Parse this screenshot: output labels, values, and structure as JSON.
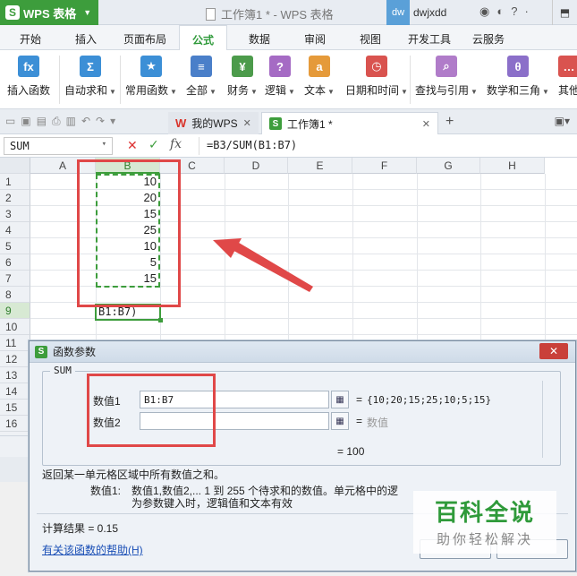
{
  "titlebar": {
    "app_name": "WPS 表格",
    "doc_title": "工作簿1 * - WPS 表格",
    "user_avatar": "dw",
    "user_name": "dwjxdd"
  },
  "menu": [
    "开始",
    "插入",
    "页面布局",
    "公式",
    "数据",
    "审阅",
    "视图",
    "开发工具",
    "云服务"
  ],
  "menu_active_index": 3,
  "ribbon": [
    {
      "label": "插入函数",
      "icon": "fx-icon",
      "glyph": "fx",
      "color": "#3c8fd6",
      "caret": false
    },
    {
      "label": "自动求和",
      "icon": "sigma-icon",
      "glyph": "Σ",
      "color": "#3c8fd6",
      "caret": true
    },
    {
      "label": "常用函数",
      "icon": "star-book-icon",
      "glyph": "★",
      "color": "#3c8fd6",
      "caret": true
    },
    {
      "label": "全部",
      "icon": "list-book-icon",
      "glyph": "≡",
      "color": "#4a7fc9",
      "caret": true
    },
    {
      "label": "财务",
      "icon": "finance-book-icon",
      "glyph": "¥",
      "color": "#4c9b4b",
      "caret": true
    },
    {
      "label": "逻辑",
      "icon": "logic-book-icon",
      "glyph": "?",
      "color": "#a56bc4",
      "caret": true
    },
    {
      "label": "文本",
      "icon": "text-book-icon",
      "glyph": "a",
      "color": "#e59a3a",
      "caret": true
    },
    {
      "label": "日期和时间",
      "icon": "clock-book-icon",
      "glyph": "◷",
      "color": "#d9534f",
      "caret": true
    },
    {
      "label": "查找与引用",
      "icon": "search-book-icon",
      "glyph": "⌕",
      "color": "#b07cc9",
      "caret": true
    },
    {
      "label": "数学和三角",
      "icon": "theta-book-icon",
      "glyph": "θ",
      "color": "#8b6fc9",
      "caret": true
    },
    {
      "label": "其他",
      "icon": "more-book-icon",
      "glyph": "…",
      "color": "#d9534f",
      "caret": false
    }
  ],
  "doc_tabs": [
    {
      "label": "我的WPS",
      "active": false
    },
    {
      "label": "工作簿1 *",
      "active": true
    }
  ],
  "formula_bar": {
    "name_box": "SUM",
    "formula": "=B3/SUM(B1:B7)"
  },
  "columns": [
    "A",
    "B",
    "C",
    "D",
    "E",
    "F",
    "G",
    "H"
  ],
  "rows": [
    "1",
    "2",
    "3",
    "4",
    "5",
    "6",
    "7",
    "8",
    "9",
    "10",
    "11",
    "12",
    "13",
    "14",
    "15",
    "16",
    "17"
  ],
  "column_b_values": [
    "10",
    "20",
    "15",
    "25",
    "10",
    "5",
    "15"
  ],
  "active_cell_text": "B1:B7)",
  "dialog": {
    "title": "函数参数",
    "function_name": "SUM",
    "arg1_label": "数值1",
    "arg1_value": "B1:B7",
    "arg1_result": "{10;20;15;25;10;5;15}",
    "arg2_label": "数值2",
    "arg2_value": "",
    "arg2_result": "数值",
    "eq": "=",
    "total": "= 100",
    "description": "返回某一单元格区域中所有数值之和。",
    "param_name": "数值1:",
    "param_text_line1": "数值1,数值2,... 1 到 255 个待求和的数值。单元格中的逻",
    "param_text_line2": "为参数键入时，逻辑值和文本有效",
    "calc_result": "计算结果 = 0.15",
    "help_link": "有关该函数的帮助(H)"
  },
  "watermark": {
    "main": "百科全说",
    "sub": "助你轻松解决"
  },
  "colors": {
    "brand_green": "#3d9d3c",
    "highlight_red": "#e04848",
    "link_blue": "#1a4fb6"
  }
}
